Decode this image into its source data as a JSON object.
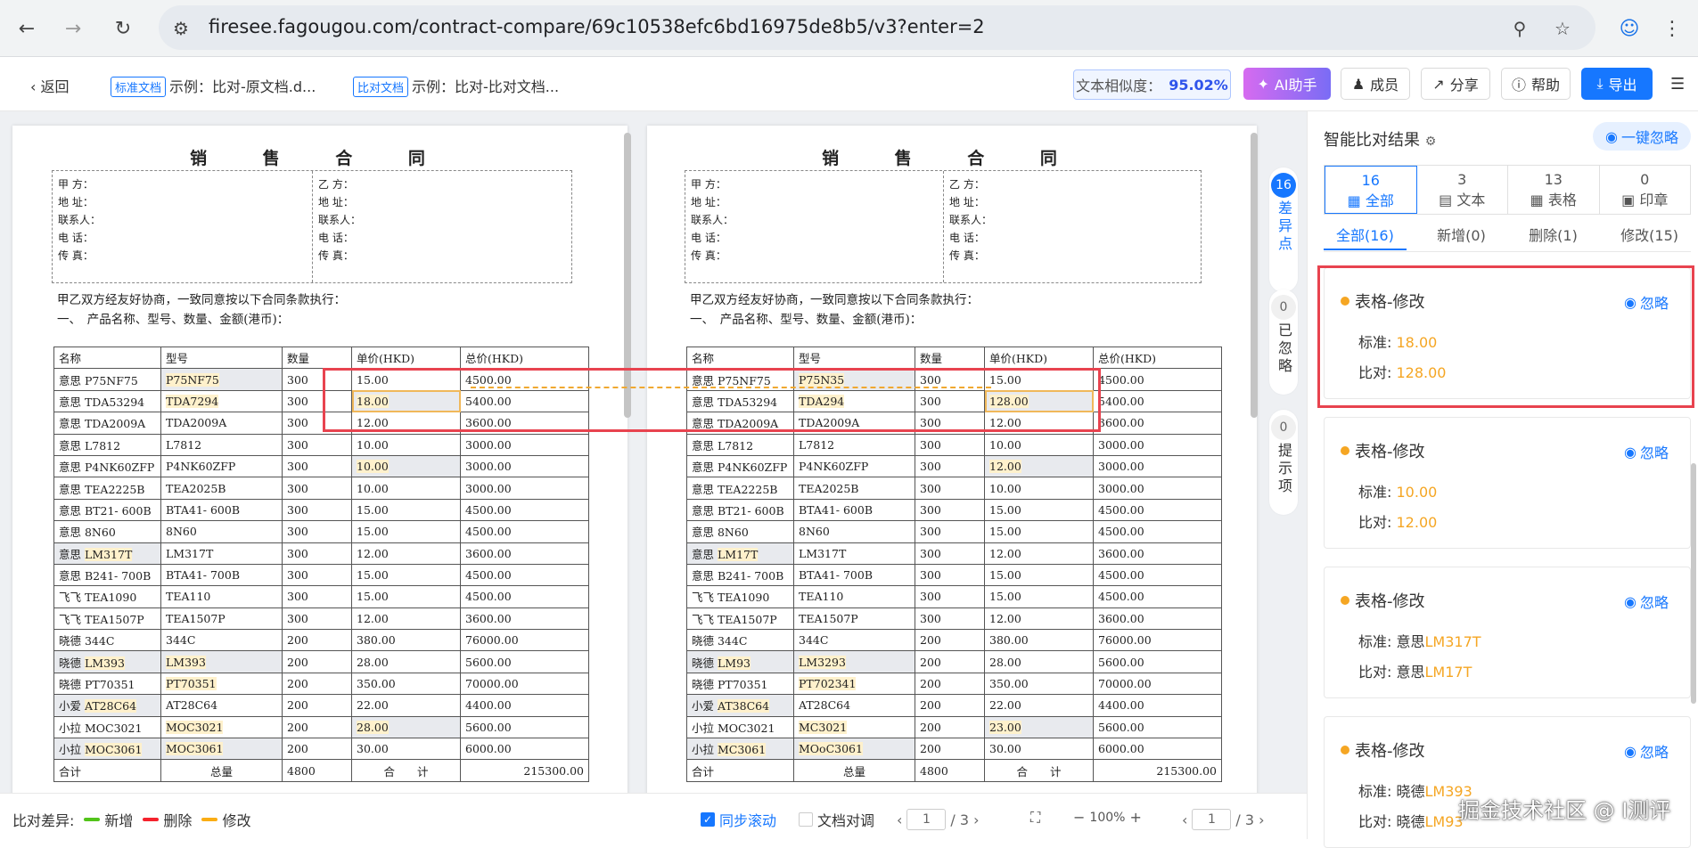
{
  "browser": {
    "url": "firesee.fagougou.com/contract-compare/69c10538efc6bd16975de8b5/v3?enter=2",
    "icons": [
      "back-arrow-icon",
      "forward-arrow-icon",
      "reload-icon",
      "site-settings-icon",
      "zoom-icon",
      "star-icon",
      "profile-icon",
      "kebab-menu-icon"
    ]
  },
  "toolbar": {
    "back_label": "返回",
    "std_tag": "标准文档",
    "std_name": "示例：比对-原文档.d...",
    "cmp_tag": "比对文档",
    "cmp_name": "示例：比对-比对文档...",
    "similarity_label": "文本相似度：",
    "similarity_value": "95.02%",
    "ai_label": "AI助手",
    "members_label": "成员",
    "share_label": "分享",
    "help_label": "帮助",
    "export_label": "导出"
  },
  "doc_left": {
    "title": "销 售 合 同",
    "party_a": [
      "甲 方：",
      "地 址：",
      "联系人：",
      "电 话：",
      "传 真："
    ],
    "party_b": [
      "乙 方：",
      "地 址：",
      "联系人：",
      "电 话：",
      "传 真："
    ],
    "intro1": "甲乙双方经友好协商，一致同意按以下合同条款执行：",
    "intro2": "一、　产品名称、型号、数量、金额(港币)：",
    "headers": [
      "名称",
      "型号",
      "数量",
      "单价(HKD)",
      "总价(HKD)"
    ],
    "rows": [
      [
        "意思 P75NF75",
        "P75NF75",
        "300",
        "15.00",
        "4500.00"
      ],
      [
        "意思 TDA53294",
        "TDA7294",
        "300",
        "18.00",
        "5400.00"
      ],
      [
        "意思 TDA2009A",
        "TDA2009A",
        "300",
        "12.00",
        "3600.00"
      ],
      [
        "意思 L7812",
        "L7812",
        "300",
        "10.00",
        "3000.00"
      ],
      [
        "意思 P4NK60ZFP",
        "P4NK60ZFP",
        "300",
        "10.00",
        "3000.00"
      ],
      [
        "意思 TEA2225B",
        "TEA2025B",
        "300",
        "10.00",
        "3000.00"
      ],
      [
        "意思 BT21- 600B",
        "BTA41- 600B",
        "300",
        "15.00",
        "4500.00"
      ],
      [
        "意思 8N60",
        "8N60",
        "300",
        "15.00",
        "4500.00"
      ],
      [
        "意思 LM317T",
        "LM317T",
        "300",
        "12.00",
        "3600.00"
      ],
      [
        "意思 B241- 700B",
        "BTA41- 700B",
        "300",
        "15.00",
        "4500.00"
      ],
      [
        "飞飞 TEA1090",
        "TEA110",
        "300",
        "15.00",
        "4500.00"
      ],
      [
        "飞飞 TEA1507P",
        "TEA1507P",
        "300",
        "12.00",
        "3600.00"
      ],
      [
        "晓德 344C",
        "344C",
        "200",
        "380.00",
        "76000.00"
      ],
      [
        "晓德 LM393",
        "LM393",
        "200",
        "28.00",
        "5600.00"
      ],
      [
        "晓德 PT70351",
        "PT70351",
        "200",
        "350.00",
        "70000.00"
      ],
      [
        "小爱 AT28C64",
        "AT28C64",
        "200",
        "22.00",
        "4400.00"
      ],
      [
        "小拉 MOC3021",
        "MOC3021",
        "200",
        "28.00",
        "5600.00"
      ],
      [
        "小拉 MOC3061",
        "MOC3061",
        "200",
        "30.00",
        "6000.00"
      ]
    ],
    "total": [
      "合计",
      "总量",
      "4800",
      "合　　计",
      "215300.00"
    ]
  },
  "doc_right": {
    "title": "销 售 合 同",
    "party_a": [
      "甲 方：",
      "地 址：",
      "联系人：",
      "电 话：",
      "传 真："
    ],
    "party_b": [
      "乙 方：",
      "地 址：",
      "联系人：",
      "电 话：",
      "传 真："
    ],
    "intro1": "甲乙双方经友好协商，一致同意按以下合同条款执行：",
    "intro2": "一、　产品名称、型号、数量、金额(港币)：",
    "headers": [
      "名称",
      "型号",
      "数量",
      "单价(HKD)",
      "总价(HKD)"
    ],
    "rows": [
      [
        "意思 P75NF75",
        "P75N35",
        "300",
        "15.00",
        "4500.00"
      ],
      [
        "意思 TDA53294",
        "TDA294",
        "300",
        "128.00",
        "5400.00"
      ],
      [
        "意思 TDA2009A",
        "TDA2009A",
        "300",
        "12.00",
        "3600.00"
      ],
      [
        "意思 L7812",
        "L7812",
        "300",
        "10.00",
        "3000.00"
      ],
      [
        "意思 P4NK60ZFP",
        "P4NK60ZFP",
        "300",
        "12.00",
        "3000.00"
      ],
      [
        "意思 TEA2225B",
        "TEA2025B",
        "300",
        "10.00",
        "3000.00"
      ],
      [
        "意思 BT21- 600B",
        "BTA41- 600B",
        "300",
        "15.00",
        "4500.00"
      ],
      [
        "意思 8N60",
        "8N60",
        "300",
        "15.00",
        "4500.00"
      ],
      [
        "意思 LM17T",
        "LM317T",
        "300",
        "12.00",
        "3600.00"
      ],
      [
        "意思 B241- 700B",
        "BTA41- 700B",
        "300",
        "15.00",
        "4500.00"
      ],
      [
        "飞飞 TEA1090",
        "TEA110",
        "300",
        "15.00",
        "4500.00"
      ],
      [
        "飞飞 TEA1507P",
        "TEA1507P",
        "300",
        "12.00",
        "3600.00"
      ],
      [
        "晓德 344C",
        "344C",
        "200",
        "380.00",
        "76000.00"
      ],
      [
        "晓德 LM93",
        "LM3293",
        "200",
        "28.00",
        "5600.00"
      ],
      [
        "晓德 PT70351",
        "PT702341",
        "200",
        "350.00",
        "70000.00"
      ],
      [
        "小爱 AT38C64",
        "AT28C64",
        "200",
        "22.00",
        "4400.00"
      ],
      [
        "小拉 MOC3021",
        "MC3021",
        "200",
        "23.00",
        "5600.00"
      ],
      [
        "小拉 MC3061",
        "MOoC3061",
        "200",
        "30.00",
        "6000.00"
      ]
    ],
    "total": [
      "合计",
      "总量",
      "4800",
      "合　　计",
      "215300.00"
    ]
  },
  "diff_nav": {
    "diff_count": "16",
    "diff_label": "差异点",
    "ignored_count": "0",
    "ignored_label": "已忽略",
    "tips_count": "0",
    "tips_label": "提示项"
  },
  "bottom": {
    "legend_label": "比对差异:",
    "legend": [
      {
        "label": "新增",
        "color": "#52c41a"
      },
      {
        "label": "删除",
        "color": "#f5222d"
      },
      {
        "label": "修改",
        "color": "#faad14"
      }
    ],
    "sync_label": "同步滚动",
    "sync_checked": true,
    "align_label": "文档对调",
    "left_page": "1",
    "left_total": "/ 3",
    "zoom": "100%",
    "right_page": "1",
    "right_total": "/ 3"
  },
  "results": {
    "title": "智能比对结果",
    "ignore_all": "一键忽略",
    "categories": [
      {
        "count": "16",
        "label": "全部",
        "icon": "grid-icon"
      },
      {
        "count": "3",
        "label": "文本",
        "icon": "document-icon"
      },
      {
        "count": "13",
        "label": "表格",
        "icon": "table-icon"
      },
      {
        "count": "0",
        "label": "印章",
        "icon": "stamp-icon"
      }
    ],
    "subtabs": [
      "全部(16)",
      "新增(0)",
      "删除(1)",
      "修改(15)"
    ],
    "cards": [
      {
        "title": "表格-修改",
        "ignore": "忽略",
        "std_label": "标准:",
        "std_prefix": "",
        "std_value": "18.00",
        "cmp_label": "比对:",
        "cmp_prefix": "",
        "cmp_value": "128.00"
      },
      {
        "title": "表格-修改",
        "ignore": "忽略",
        "std_label": "标准:",
        "std_prefix": "",
        "std_value": "10.00",
        "cmp_label": "比对:",
        "cmp_prefix": "",
        "cmp_value": "12.00"
      },
      {
        "title": "表格-修改",
        "ignore": "忽略",
        "std_label": "标准:",
        "std_prefix": "意思",
        "std_value": "LM317T",
        "cmp_label": "比对:",
        "cmp_prefix": "意思",
        "cmp_value": "LM17T"
      },
      {
        "title": "表格-修改",
        "ignore": "忽略",
        "std_label": "标准:",
        "std_prefix": "晓德",
        "std_value": "LM393",
        "cmp_label": "比对:",
        "cmp_prefix": "晓德",
        "cmp_value": "LM93"
      }
    ]
  },
  "watermark": "掘金技术社区 @ I测评",
  "colors": {
    "accent": "#1677ff",
    "modify": "#f5a623",
    "highlight_box": "#e8434f"
  }
}
